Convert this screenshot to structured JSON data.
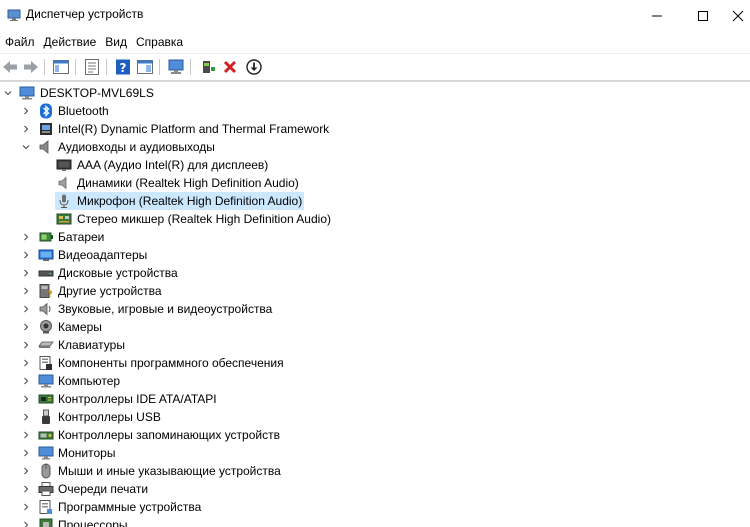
{
  "window": {
    "title": "Диспетчер устройств"
  },
  "menu": [
    "Файл",
    "Действие",
    "Вид",
    "Справка"
  ],
  "toolbar": {
    "buttons": [
      "back-icon",
      "forward-icon",
      "show-hide-tree-icon",
      "properties-icon",
      "help-icon",
      "action-view-icon",
      "scan-hardware-icon",
      "update-driver-icon",
      "uninstall-icon",
      "download-icon"
    ]
  },
  "tree": {
    "root": "DESKTOP-MVL69LS",
    "bluetooth": "Bluetooth",
    "intel_dptf": "Intel(R) Dynamic Platform and Thermal Framework",
    "audio_io": "Аудиовходы и аудиовыходы",
    "audio_children": [
      "AAA (Аудио Intel(R) для дисплеев)",
      "Динамики (Realtek High Definition Audio)",
      "Микрофон (Realtek High Definition Audio)",
      "Стерео микшер (Realtek High Definition Audio)"
    ],
    "categories": [
      "Батареи",
      "Видеоадаптеры",
      "Дисковые устройства",
      "Другие устройства",
      "Звуковые, игровые и видеоустройства",
      "Камеры",
      "Клавиатуры",
      "Компоненты программного обеспечения",
      "Компьютер",
      "Контроллеры IDE ATA/ATAPI",
      "Контроллеры USB",
      "Контроллеры запоминающих устройств",
      "Мониторы",
      "Мыши и иные указывающие устройства",
      "Очереди печати",
      "Программные устройства",
      "Процессоры"
    ],
    "selected": "Микрофон (Realtek High Definition Audio)"
  },
  "colors": {
    "selection": "#cce8ff",
    "accent_blue": "#1e6fd9",
    "delete_red": "#d42020"
  }
}
